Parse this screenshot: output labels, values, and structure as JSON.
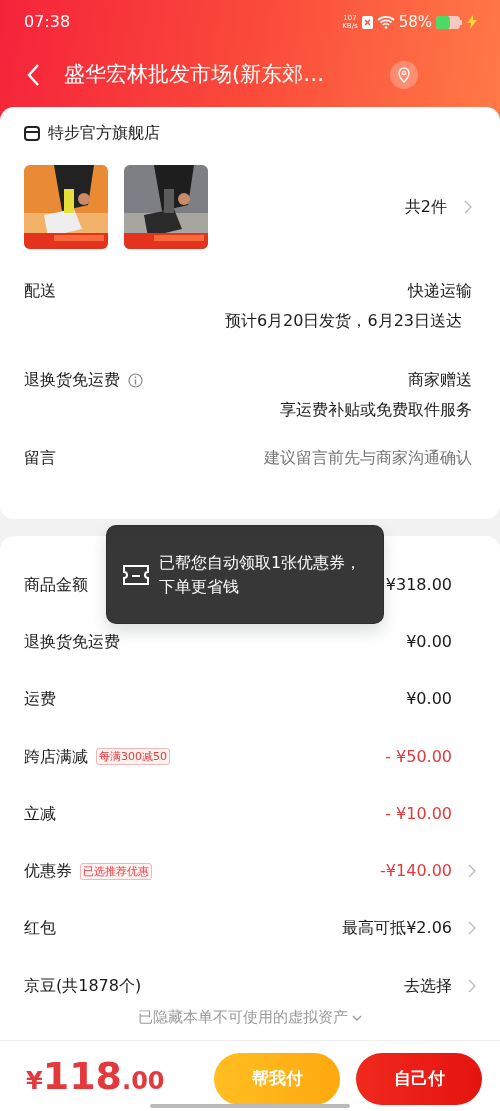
{
  "status_bar": {
    "time": "07:38",
    "net_speed": "107",
    "net_unit": "KB/s",
    "battery": "58%",
    "charging": true
  },
  "header": {
    "title": "盛华宏林批发市场(新东郊…"
  },
  "store": {
    "name": "特步官方旗舰店",
    "count": "共2件"
  },
  "delivery_rows": [
    {
      "label": "配送",
      "value": "快递运输",
      "note": "预计6月20日发货，6月23日送达",
      "info": false
    },
    {
      "label": "退换货免运费",
      "value": "商家赠送",
      "note": "享运费补贴或免费取件服务",
      "info": true
    }
  ],
  "message": {
    "label": "留言",
    "placeholder": "建议留言前先与商家沟通确认"
  },
  "price_rows": [
    {
      "label": "商品金额",
      "value": "¥318.00",
      "discount": false,
      "arrow": false
    },
    {
      "label": "退换货免运费",
      "value": "¥0.00",
      "discount": false,
      "arrow": false
    },
    {
      "label": "运费",
      "value": "¥0.00",
      "discount": false,
      "arrow": false
    },
    {
      "label": "跨店满减",
      "tag": "每满300减50",
      "value": "- ¥50.00",
      "discount": true,
      "arrow": false
    },
    {
      "label": "立减",
      "value": "- ¥10.00",
      "discount": true,
      "arrow": false
    },
    {
      "label": "优惠券",
      "tag": "已选推荐优惠",
      "value": "-¥140.00",
      "discount": true,
      "arrow": true
    },
    {
      "label": "红包",
      "value": "最高可抵¥2.06",
      "discount": false,
      "arrow": true
    },
    {
      "label": "京豆(共1878个)",
      "value": "去选择",
      "discount": false,
      "arrow": true
    }
  ],
  "hidden_note": "已隐藏本单不可使用的虚拟资产",
  "toast": {
    "text": "已帮您自动领取1张优惠券，下单更省钱"
  },
  "footer": {
    "currency": "¥",
    "amount": "118",
    "decimals": ".00",
    "buttons": [
      {
        "label": "帮我付",
        "kind": "secondary"
      },
      {
        "label": "自己付",
        "kind": "primary"
      }
    ]
  }
}
